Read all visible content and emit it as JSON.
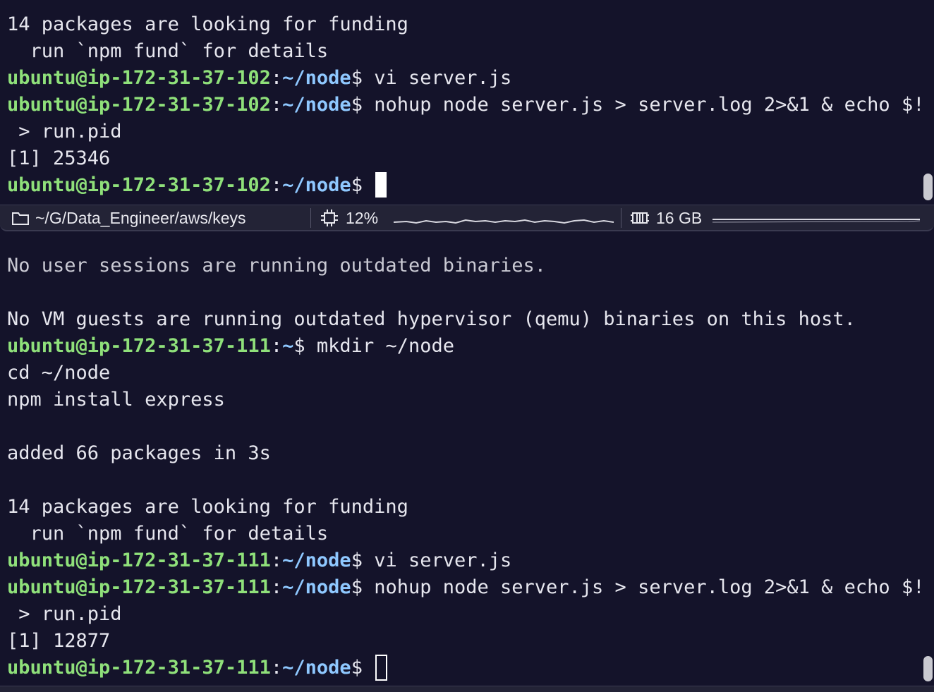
{
  "top_pane": {
    "lines": [
      [
        {
          "t": "14 packages are looking for funding",
          "c": "w"
        }
      ],
      [
        {
          "t": "  run `npm fund` for details",
          "c": "w"
        }
      ],
      [
        {
          "t": "ubuntu@ip-172-31-37-102",
          "c": "g"
        },
        {
          "t": ":",
          "c": "w"
        },
        {
          "t": "~/node",
          "c": "b"
        },
        {
          "t": "$ vi server.js",
          "c": "w"
        }
      ],
      [
        {
          "t": "ubuntu@ip-172-31-37-102",
          "c": "g"
        },
        {
          "t": ":",
          "c": "w"
        },
        {
          "t": "~/node",
          "c": "b"
        },
        {
          "t": "$ nohup node server.js > server.log 2>&1 & echo $!",
          "c": "w"
        }
      ],
      [
        {
          "t": " > run.pid",
          "c": "w"
        }
      ],
      [
        {
          "t": "[1] 25346",
          "c": "w"
        }
      ],
      [
        {
          "t": "ubuntu@ip-172-31-37-102",
          "c": "g"
        },
        {
          "t": ":",
          "c": "w"
        },
        {
          "t": "~/node",
          "c": "b"
        },
        {
          "t": "$ ",
          "c": "w"
        },
        {
          "cursor": "block"
        }
      ]
    ]
  },
  "status_bar": {
    "path": "~/G/Data_Engineer/aws/keys",
    "cpu": "12%",
    "memory": "16 GB"
  },
  "bottom_pane": {
    "lines": [
      [
        {
          "t": "No user sessions are running outdated binaries.",
          "c": "dim"
        }
      ],
      [],
      [
        {
          "t": "No VM guests are running outdated hypervisor (qemu) binaries on this host.",
          "c": "w"
        }
      ],
      [
        {
          "t": "ubuntu@ip-172-31-37-111",
          "c": "g"
        },
        {
          "t": ":",
          "c": "w"
        },
        {
          "t": "~",
          "c": "b"
        },
        {
          "t": "$ mkdir ~/node",
          "c": "w"
        }
      ],
      [
        {
          "t": "cd ~/node",
          "c": "w"
        }
      ],
      [
        {
          "t": "npm install express",
          "c": "w"
        }
      ],
      [],
      [
        {
          "t": "added 66 packages in 3s",
          "c": "w"
        }
      ],
      [],
      [
        {
          "t": "14 packages are looking for funding",
          "c": "w"
        }
      ],
      [
        {
          "t": "  run `npm fund` for details",
          "c": "w"
        }
      ],
      [
        {
          "t": "ubuntu@ip-172-31-37-111",
          "c": "g"
        },
        {
          "t": ":",
          "c": "w"
        },
        {
          "t": "~/node",
          "c": "b"
        },
        {
          "t": "$ vi server.js",
          "c": "w"
        }
      ],
      [
        {
          "t": "ubuntu@ip-172-31-37-111",
          "c": "g"
        },
        {
          "t": ":",
          "c": "w"
        },
        {
          "t": "~/node",
          "c": "b"
        },
        {
          "t": "$ nohup node server.js > server.log 2>&1 & echo $!",
          "c": "w"
        }
      ],
      [
        {
          "t": " > run.pid",
          "c": "w"
        }
      ],
      [
        {
          "t": "[1] 12877",
          "c": "w"
        }
      ],
      [
        {
          "t": "ubuntu@ip-172-31-37-111",
          "c": "g"
        },
        {
          "t": ":",
          "c": "w"
        },
        {
          "t": "~/node",
          "c": "b"
        },
        {
          "t": "$ ",
          "c": "w"
        },
        {
          "cursor": "hollow"
        }
      ]
    ]
  },
  "colors": {
    "background": "#14132a",
    "prompt_user": "#8fe07a",
    "prompt_path": "#8fc8ff",
    "text": "#e6e6ee",
    "status_bar": "#232336"
  },
  "icons": {
    "folder": "folder-icon",
    "cpu": "cpu-chip-icon",
    "memory": "memory-icon"
  }
}
